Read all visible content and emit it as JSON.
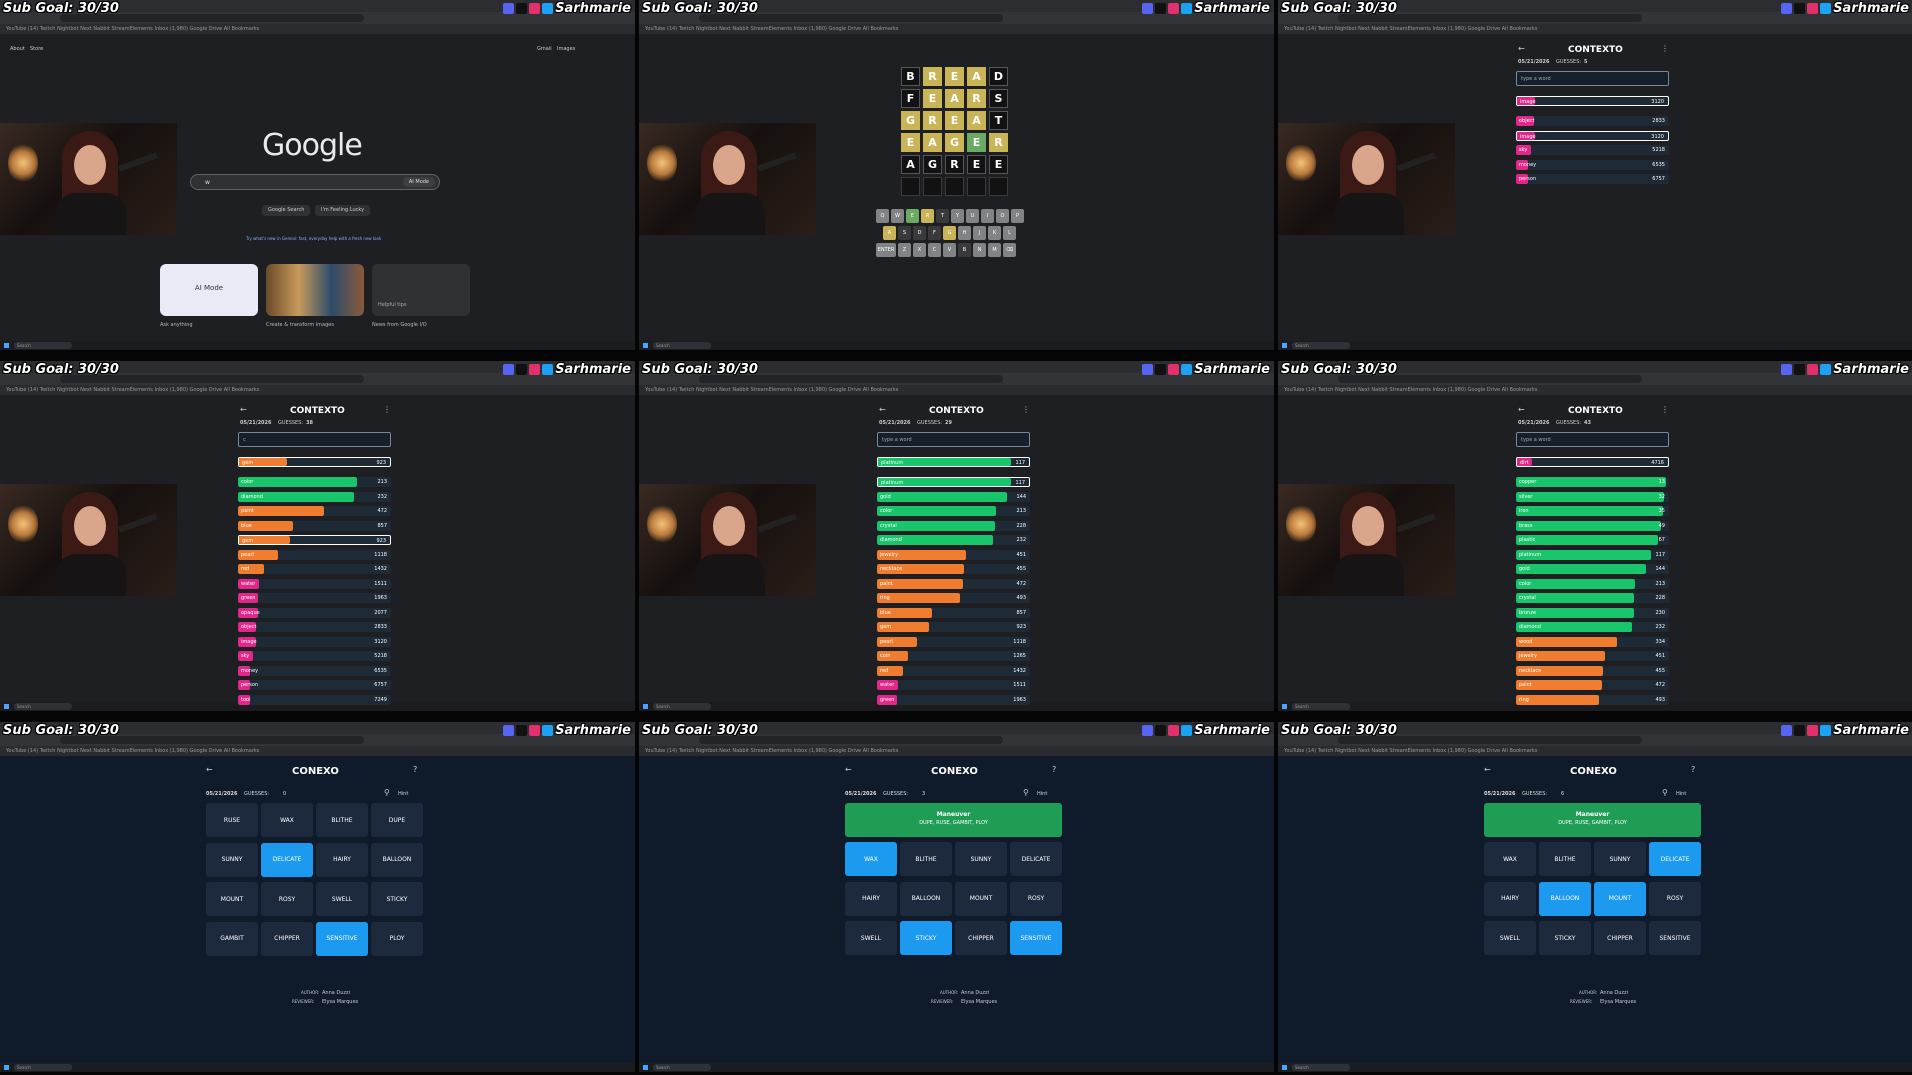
{
  "overlay": {
    "sub_goal": "Sub Goal: 30/30",
    "streamer": "Sarhmarie"
  },
  "browser": {
    "bookmarks": "YouTube  (14) Twitch  Nightbot  Next Nabbit  StreamElements  Inbox (1,980)  Google Drive        All Bookmarks"
  },
  "taskbar": {
    "search": "Search"
  },
  "google": {
    "top_left": [
      "About",
      "Store"
    ],
    "top_right": [
      "Gmail",
      "Images"
    ],
    "logo": "Google",
    "query": "w",
    "ai_mode": "AI Mode",
    "btn_search": "Google Search",
    "btn_lucky": "I'm Feeling Lucky",
    "tip": "Try what's new in Gemini: fast, everyday help with a fresh new look",
    "cards": [
      {
        "label": "AI Mode",
        "caption": "Ask anything"
      },
      {
        "label": "",
        "caption": "Create & transform images"
      },
      {
        "label": "Helpful tips",
        "caption": "News from Google I/O"
      }
    ]
  },
  "wordle": {
    "rows": [
      [
        {
          "l": "B",
          "s": "f"
        },
        {
          "l": "R",
          "s": "y"
        },
        {
          "l": "E",
          "s": "y"
        },
        {
          "l": "A",
          "s": "y"
        },
        {
          "l": "D",
          "s": "f"
        }
      ],
      [
        {
          "l": "F",
          "s": "f"
        },
        {
          "l": "E",
          "s": "y"
        },
        {
          "l": "A",
          "s": "y"
        },
        {
          "l": "R",
          "s": "y"
        },
        {
          "l": "S",
          "s": "f"
        }
      ],
      [
        {
          "l": "G",
          "s": "y"
        },
        {
          "l": "R",
          "s": "y"
        },
        {
          "l": "E",
          "s": "y"
        },
        {
          "l": "A",
          "s": "y"
        },
        {
          "l": "T",
          "s": "f"
        }
      ],
      [
        {
          "l": "E",
          "s": "y"
        },
        {
          "l": "A",
          "s": "y"
        },
        {
          "l": "G",
          "s": "y"
        },
        {
          "l": "E",
          "s": "g"
        },
        {
          "l": "R",
          "s": "y"
        }
      ],
      [
        {
          "l": "A",
          "s": ""
        },
        {
          "l": "G",
          "s": ""
        },
        {
          "l": "R",
          "s": ""
        },
        {
          "l": "E",
          "s": ""
        },
        {
          "l": "E",
          "s": ""
        }
      ],
      [
        {
          "l": "",
          "s": ""
        },
        {
          "l": "",
          "s": ""
        },
        {
          "l": "",
          "s": ""
        },
        {
          "l": "",
          "s": ""
        },
        {
          "l": "",
          "s": ""
        }
      ]
    ],
    "keyboard": [
      [
        "Q",
        "W",
        "E",
        "R",
        "T",
        "Y",
        "U",
        "I",
        "O",
        "P"
      ],
      [
        "A",
        "S",
        "D",
        "F",
        "G",
        "H",
        "J",
        "K",
        "L"
      ],
      [
        "ENTER",
        "Z",
        "X",
        "C",
        "V",
        "B",
        "N",
        "M",
        "⌫"
      ]
    ],
    "key_states": {
      "E": "k-g",
      "R": "k-y",
      "A": "k-y",
      "G": "k-y",
      "B": "k-d",
      "D": "k-d",
      "F": "k-d",
      "S": "k-d",
      "T": "k-d"
    },
    "subscribe": "Subscribe to Games"
  },
  "contexto": [
    {
      "title": "CONTEXTO",
      "date": "05/21/2026",
      "guesses_label": "GUESSES:",
      "guesses": "5",
      "input": "type a word",
      "top": {
        "word": "image",
        "num": "3120",
        "pct": 0.12,
        "color": "#e3278a"
      },
      "rows": [
        {
          "word": "object",
          "num": "2833",
          "pct": 0.12,
          "color": "#e3278a"
        },
        {
          "word": "image",
          "num": "3120",
          "pct": 0.12,
          "color": "#e3278a",
          "hl": true
        },
        {
          "word": "sky",
          "num": "5218",
          "pct": 0.1,
          "color": "#e3278a"
        },
        {
          "word": "money",
          "num": "6535",
          "pct": 0.08,
          "color": "#e3278a"
        },
        {
          "word": "person",
          "num": "6757",
          "pct": 0.08,
          "color": "#e3278a"
        }
      ]
    },
    {
      "title": "CONTEXTO",
      "date": "05/21/2026",
      "guesses_label": "GUESSES:",
      "guesses": "38",
      "input": "c",
      "top": {
        "word": "gem",
        "num": "923",
        "pct": 0.32,
        "color": "#f07c30"
      },
      "rows": [
        {
          "word": "color",
          "num": "213",
          "pct": 0.78,
          "color": "#19c56b"
        },
        {
          "word": "diamond",
          "num": "232",
          "pct": 0.76,
          "color": "#19c56b"
        },
        {
          "word": "paint",
          "num": "472",
          "pct": 0.56,
          "color": "#f07c30"
        },
        {
          "word": "blue",
          "num": "857",
          "pct": 0.36,
          "color": "#f07c30"
        },
        {
          "word": "gem",
          "num": "923",
          "pct": 0.34,
          "color": "#f07c30",
          "hl": true
        },
        {
          "word": "pearl",
          "num": "1118",
          "pct": 0.26,
          "color": "#f07c30"
        },
        {
          "word": "red",
          "num": "1432",
          "pct": 0.17,
          "color": "#f07c30"
        },
        {
          "word": "water",
          "num": "1511",
          "pct": 0.14,
          "color": "#e3278a"
        },
        {
          "word": "green",
          "num": "1963",
          "pct": 0.13,
          "color": "#e3278a"
        },
        {
          "word": "opaque",
          "num": "2077",
          "pct": 0.13,
          "color": "#e3278a"
        },
        {
          "word": "object",
          "num": "2833",
          "pct": 0.12,
          "color": "#e3278a"
        },
        {
          "word": "image",
          "num": "3120",
          "pct": 0.12,
          "color": "#e3278a"
        },
        {
          "word": "sky",
          "num": "5218",
          "pct": 0.1,
          "color": "#e3278a"
        },
        {
          "word": "money",
          "num": "6535",
          "pct": 0.08,
          "color": "#e3278a"
        },
        {
          "word": "person",
          "num": "6757",
          "pct": 0.08,
          "color": "#e3278a"
        },
        {
          "word": "tool",
          "num": "7249",
          "pct": 0.08,
          "color": "#e3278a"
        }
      ]
    },
    {
      "title": "CONTEXTO",
      "date": "05/21/2026",
      "guesses_label": "GUESSES:",
      "guesses": "29",
      "input": "type a word",
      "top": {
        "word": "platinum",
        "num": "117",
        "pct": 0.88,
        "color": "#19c56b"
      },
      "rows": [
        {
          "word": "platinum",
          "num": "117",
          "pct": 0.88,
          "color": "#19c56b",
          "hl": true
        },
        {
          "word": "gold",
          "num": "144",
          "pct": 0.85,
          "color": "#19c56b"
        },
        {
          "word": "color",
          "num": "213",
          "pct": 0.78,
          "color": "#19c56b"
        },
        {
          "word": "crystal",
          "num": "228",
          "pct": 0.77,
          "color": "#19c56b"
        },
        {
          "word": "diamond",
          "num": "232",
          "pct": 0.76,
          "color": "#19c56b"
        },
        {
          "word": "jewelry",
          "num": "451",
          "pct": 0.58,
          "color": "#f07c30"
        },
        {
          "word": "necklace",
          "num": "455",
          "pct": 0.57,
          "color": "#f07c30"
        },
        {
          "word": "paint",
          "num": "472",
          "pct": 0.56,
          "color": "#f07c30"
        },
        {
          "word": "ring",
          "num": "493",
          "pct": 0.54,
          "color": "#f07c30"
        },
        {
          "word": "blue",
          "num": "857",
          "pct": 0.36,
          "color": "#f07c30"
        },
        {
          "word": "gem",
          "num": "923",
          "pct": 0.34,
          "color": "#f07c30"
        },
        {
          "word": "pearl",
          "num": "1118",
          "pct": 0.26,
          "color": "#f07c30"
        },
        {
          "word": "coin",
          "num": "1265",
          "pct": 0.2,
          "color": "#f07c30"
        },
        {
          "word": "red",
          "num": "1432",
          "pct": 0.17,
          "color": "#f07c30"
        },
        {
          "word": "water",
          "num": "1511",
          "pct": 0.14,
          "color": "#e3278a"
        },
        {
          "word": "green",
          "num": "1963",
          "pct": 0.13,
          "color": "#e3278a"
        }
      ]
    },
    {
      "title": "CONTEXTO",
      "date": "05/21/2026",
      "guesses_label": "GUESSES:",
      "guesses": "43",
      "input": "type a word",
      "top": {
        "word": "dirt",
        "num": "4716",
        "pct": 0.1,
        "color": "#e3278a"
      },
      "rows": [
        {
          "word": "copper",
          "num": "13",
          "pct": 0.98,
          "color": "#19c56b"
        },
        {
          "word": "silver",
          "num": "32",
          "pct": 0.97,
          "color": "#19c56b"
        },
        {
          "word": "iron",
          "num": "35",
          "pct": 0.96,
          "color": "#19c56b"
        },
        {
          "word": "brass",
          "num": "49",
          "pct": 0.95,
          "color": "#19c56b"
        },
        {
          "word": "plastic",
          "num": "67",
          "pct": 0.93,
          "color": "#19c56b"
        },
        {
          "word": "platinum",
          "num": "117",
          "pct": 0.88,
          "color": "#19c56b"
        },
        {
          "word": "gold",
          "num": "144",
          "pct": 0.85,
          "color": "#19c56b"
        },
        {
          "word": "color",
          "num": "213",
          "pct": 0.78,
          "color": "#19c56b"
        },
        {
          "word": "crystal",
          "num": "228",
          "pct": 0.77,
          "color": "#19c56b"
        },
        {
          "word": "bronze",
          "num": "230",
          "pct": 0.77,
          "color": "#19c56b"
        },
        {
          "word": "diamond",
          "num": "232",
          "pct": 0.76,
          "color": "#19c56b"
        },
        {
          "word": "wood",
          "num": "334",
          "pct": 0.66,
          "color": "#f07c30"
        },
        {
          "word": "jewelry",
          "num": "451",
          "pct": 0.58,
          "color": "#f07c30"
        },
        {
          "word": "necklace",
          "num": "455",
          "pct": 0.57,
          "color": "#f07c30"
        },
        {
          "word": "paint",
          "num": "472",
          "pct": 0.56,
          "color": "#f07c30"
        },
        {
          "word": "ring",
          "num": "493",
          "pct": 0.54,
          "color": "#f07c30"
        }
      ]
    }
  ],
  "conexo": [
    {
      "title": "CONEXO",
      "date": "05/21/2026",
      "guesses_label": "GUESSES:",
      "guesses": "0",
      "hint": "Hint",
      "group": null,
      "tiles": [
        [
          "RUSE",
          "WAX",
          "BLITHE",
          "DUPE"
        ],
        [
          "SUNNY",
          "DELICATE",
          "HAIRY",
          "BALLOON"
        ],
        [
          "MOUNT",
          "ROSY",
          "SWELL",
          "STICKY"
        ],
        [
          "GAMBIT",
          "CHIPPER",
          "SENSITIVE",
          "PLOY"
        ]
      ],
      "selected": [
        "DELICATE",
        "SENSITIVE"
      ],
      "author_label": "AUTHOR:",
      "author": "Anna Duzzi",
      "reviewer_label": "REVIEWER:",
      "reviewer": "Elysa Marques"
    },
    {
      "title": "CONEXO",
      "date": "05/21/2026",
      "guesses_label": "GUESSES:",
      "guesses": "3",
      "hint": "Hint",
      "group": {
        "title": "Maneuver",
        "words": "DUPE, RUSE, GAMBIT, PLOY"
      },
      "tiles": [
        [
          "WAX",
          "BLITHE",
          "SUNNY",
          "DELICATE"
        ],
        [
          "HAIRY",
          "BALLOON",
          "MOUNT",
          "ROSY"
        ],
        [
          "SWELL",
          "STICKY",
          "CHIPPER",
          "SENSITIVE"
        ]
      ],
      "selected": [
        "WAX",
        "STICKY",
        "SENSITIVE"
      ],
      "author_label": "AUTHOR:",
      "author": "Anna Duzzi",
      "reviewer_label": "REVIEWER:",
      "reviewer": "Elysa Marques"
    },
    {
      "title": "CONEXO",
      "date": "05/21/2026",
      "guesses_label": "GUESSES:",
      "guesses": "6",
      "hint": "Hint",
      "group": {
        "title": "Maneuver",
        "words": "DUPE, RUSE, GAMBIT, PLOY"
      },
      "tiles": [
        [
          "WAX",
          "BLITHE",
          "SUNNY",
          "DELICATE"
        ],
        [
          "HAIRY",
          "BALLOON",
          "MOUNT",
          "ROSY"
        ],
        [
          "SWELL",
          "STICKY",
          "CHIPPER",
          "SENSITIVE"
        ]
      ],
      "selected": [
        "DELICATE",
        "BALLOON",
        "MOUNT"
      ],
      "author_label": "AUTHOR:",
      "author": "Anna Duzzi",
      "reviewer_label": "REVIEWER:",
      "reviewer": "Elysa Marques"
    }
  ]
}
